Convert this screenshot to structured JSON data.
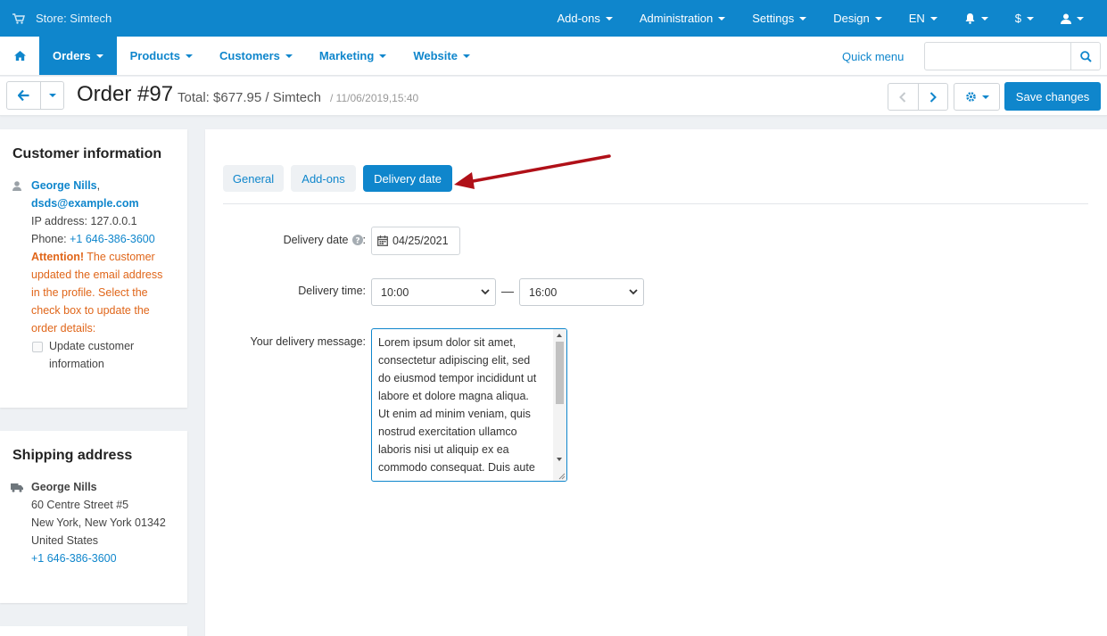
{
  "topbar": {
    "store": "Store: Simtech",
    "menu": [
      "Add-ons",
      "Administration",
      "Settings",
      "Design",
      "EN"
    ],
    "currency": "$"
  },
  "mainnav": {
    "items": [
      "Orders",
      "Products",
      "Customers",
      "Marketing",
      "Website"
    ],
    "active": "Orders",
    "quick_menu": "Quick menu",
    "search_placeholder": ""
  },
  "titlebar": {
    "title": "Order #97",
    "subtitle": "Total: $677.95 / Simtech",
    "date": "/ 11/06/2019,15:40",
    "save_label": "Save changes"
  },
  "customer_info": {
    "heading": "Customer information",
    "name": "George Nills",
    "email": "dsds@example.com",
    "ip_label": "IP address:",
    "ip": "127.0.0.1",
    "phone_label": "Phone:",
    "phone": "+1 646-386-3600",
    "attention_label": "Attention!",
    "attention_lines": [
      "The customer",
      "updated the email address",
      "in the profile. Select the",
      "check box to update the",
      "order details:"
    ],
    "checkbox_lines": [
      "Update customer",
      "information"
    ]
  },
  "shipping": {
    "heading": "Shipping address",
    "name": "George Nills",
    "address_lines": [
      "60 Centre Street #5",
      "New York, New York 01342",
      "United States"
    ],
    "phone": "+1 646-386-3600"
  },
  "tabs": [
    {
      "label": "General",
      "active": false
    },
    {
      "label": "Add-ons",
      "active": false
    },
    {
      "label": "Delivery date",
      "active": true
    }
  ],
  "form": {
    "delivery_date_label": "Delivery date",
    "delivery_date_value": "04/25/2021",
    "delivery_time_label": "Delivery time:",
    "time_from": "10:00",
    "time_separator": "—",
    "time_to": "16:00",
    "message_label": "Your delivery message:",
    "message_lines": [
      "Lorem ipsum dolor sit amet,",
      "consectetur adipiscing elit, sed",
      "do eiusmod tempor incididunt ut",
      "labore et dolore magna aliqua.",
      "Ut enim ad minim veniam, quis",
      "nostrud exercitation ullamco",
      "laboris nisi ut aliquip ex ea",
      "commodo consequat. Duis aute"
    ]
  },
  "colors": {
    "primary": "#0f86cc",
    "warning": "#e0661a",
    "arrow": "#b01018"
  }
}
